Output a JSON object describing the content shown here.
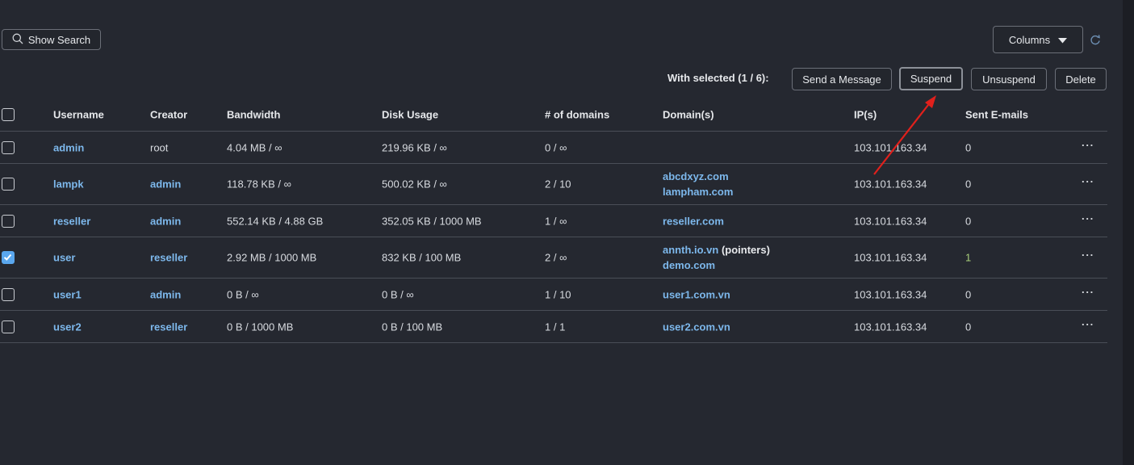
{
  "toolbar": {
    "show_search_label": "Show Search",
    "columns_label": "Columns",
    "with_selected": "With selected (1 / 6):",
    "send_message_label": "Send a Message",
    "suspend_label": "Suspend",
    "unsuspend_label": "Unsuspend",
    "delete_label": "Delete"
  },
  "table": {
    "headers": [
      "Username",
      "Creator",
      "Bandwidth",
      "Disk Usage",
      "# of domains",
      "Domain(s)",
      "IP(s)",
      "Sent E-mails"
    ],
    "rows": [
      {
        "checked": false,
        "username": "admin",
        "creator": "root",
        "bandwidth": "4.04 MB / ∞",
        "disk": "219.96 KB / ∞",
        "ndomains": "0 / ∞",
        "domains": [],
        "ip": "103.101.163.34",
        "emails": "0"
      },
      {
        "checked": false,
        "username": "lampk",
        "creator": "admin",
        "bandwidth": "118.78 KB / ∞",
        "disk": "500.02 KB / ∞",
        "ndomains": "2 / 10",
        "domains": [
          "abcdxyz.com",
          "lampham.com"
        ],
        "ip": "103.101.163.34",
        "emails": "0"
      },
      {
        "checked": false,
        "username": "reseller",
        "creator": "admin",
        "bandwidth": "552.14 KB / 4.88 GB",
        "disk": "352.05 KB / 1000 MB",
        "ndomains": "1 / ∞",
        "domains": [
          "reseller.com"
        ],
        "ip": "103.101.163.34",
        "emails": "0"
      },
      {
        "checked": true,
        "username": "user",
        "creator": "reseller",
        "bandwidth": "2.92 MB / 1000 MB",
        "disk": "832 KB / 100 MB",
        "ndomains": "2 / ∞",
        "domains": [
          "annth.io.vn",
          "demo.com"
        ],
        "domain_note": "(pointers)",
        "ip": "103.101.163.34",
        "emails": "1"
      },
      {
        "checked": false,
        "username": "user1",
        "creator": "admin",
        "bandwidth": "0 B / ∞",
        "disk": "0 B / ∞",
        "ndomains": "1 / 10",
        "domains": [
          "user1.com.vn"
        ],
        "ip": "103.101.163.34",
        "emails": "0"
      },
      {
        "checked": false,
        "username": "user2",
        "creator": "reseller",
        "bandwidth": "0 B / 1000 MB",
        "disk": "0 B / 100 MB",
        "ndomains": "1 / 1",
        "domains": [
          "user2.com.vn"
        ],
        "ip": "103.101.163.34",
        "emails": "0"
      }
    ],
    "row_menu": "···"
  },
  "icons": {
    "search": "search-icon",
    "caret": "caret-down-icon",
    "refresh": "refresh-icon",
    "checkbox": "checkbox-icon",
    "more": "more-horizontal-icon",
    "arrow": "annotation-arrow"
  },
  "colors": {
    "background": "#252830",
    "link": "#7db8ec",
    "checked": "#5aa7ee",
    "annotation": "#e0201c"
  }
}
